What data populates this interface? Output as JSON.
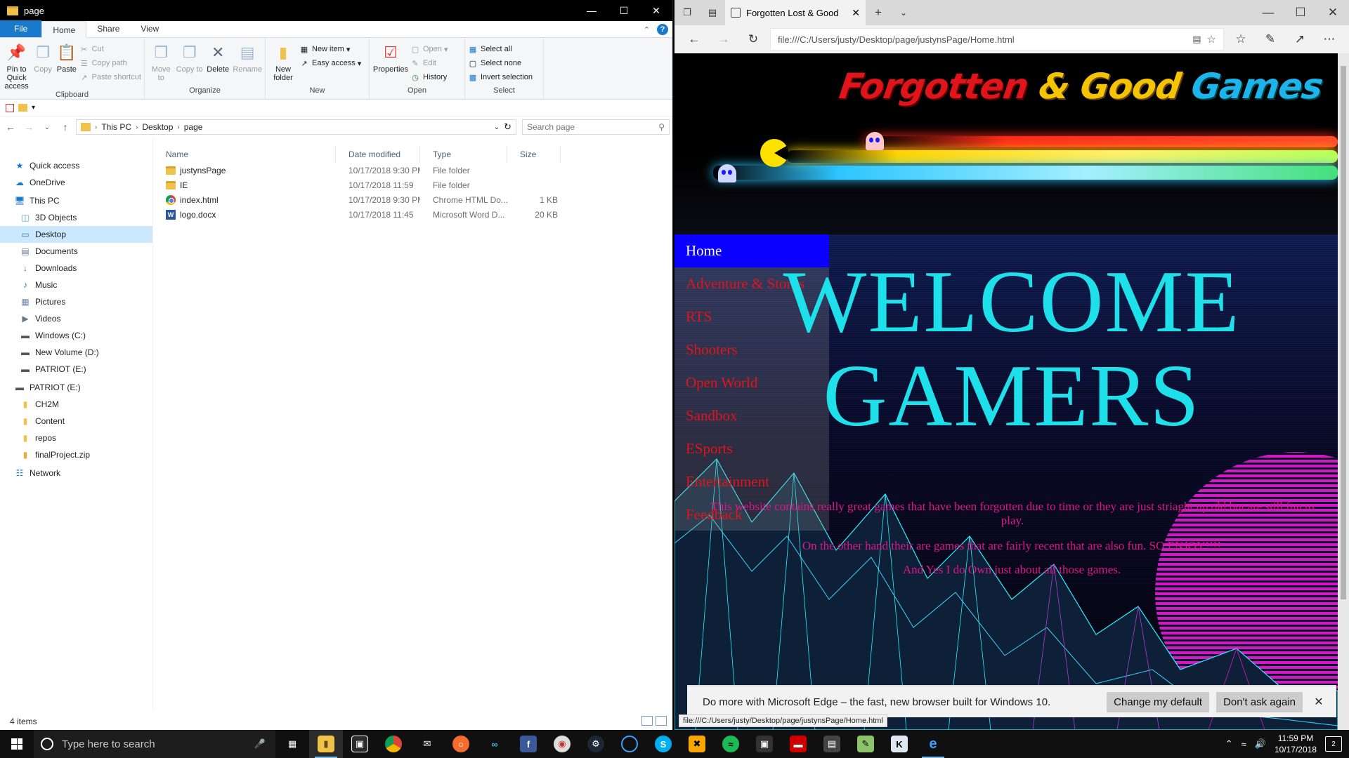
{
  "explorer": {
    "title": "page",
    "ribbon_tabs": [
      "File",
      "Home",
      "Share",
      "View"
    ],
    "groups": {
      "clipboard": {
        "label": "Clipboard",
        "pin": "Pin to Quick access",
        "copy": "Copy",
        "paste": "Paste",
        "cut": "Cut",
        "copy_path": "Copy path",
        "paste_shortcut": "Paste shortcut"
      },
      "organize": {
        "label": "Organize",
        "move_to": "Move to",
        "copy_to": "Copy to",
        "delete": "Delete",
        "rename": "Rename"
      },
      "new": {
        "label": "New",
        "new_folder": "New folder",
        "new_item": "New item",
        "easy_access": "Easy access"
      },
      "open": {
        "label": "Open",
        "properties": "Properties",
        "open": "Open",
        "edit": "Edit",
        "history": "History"
      },
      "select": {
        "label": "Select",
        "select_all": "Select all",
        "select_none": "Select none",
        "invert_selection": "Invert selection"
      }
    },
    "breadcrumb": [
      "This PC",
      "Desktop",
      "page"
    ],
    "search_placeholder": "Search page",
    "nav_pane": [
      {
        "label": "Quick access",
        "icon": "star-icon",
        "indent": 1
      },
      {
        "label": "OneDrive",
        "icon": "cloud-icon",
        "indent": 1
      },
      {
        "label": "This PC",
        "icon": "computer-icon",
        "indent": 1
      },
      {
        "label": "3D Objects",
        "icon": "cube-icon",
        "indent": 2
      },
      {
        "label": "Desktop",
        "icon": "desktop-icon",
        "indent": 2,
        "selected": true
      },
      {
        "label": "Documents",
        "icon": "document-icon",
        "indent": 2
      },
      {
        "label": "Downloads",
        "icon": "download-icon",
        "indent": 2
      },
      {
        "label": "Music",
        "icon": "music-icon",
        "indent": 2
      },
      {
        "label": "Pictures",
        "icon": "picture-icon",
        "indent": 2
      },
      {
        "label": "Videos",
        "icon": "video-icon",
        "indent": 2
      },
      {
        "label": "Windows (C:)",
        "icon": "drive-icon",
        "indent": 2
      },
      {
        "label": "New Volume (D:)",
        "icon": "drive-icon",
        "indent": 2
      },
      {
        "label": "PATRIOT (E:)",
        "icon": "usb-drive-icon",
        "indent": 2
      },
      {
        "label": "PATRIOT (E:)",
        "icon": "usb-drive-icon",
        "indent": 1
      },
      {
        "label": "CH2M",
        "icon": "folder-icon",
        "indent": 2
      },
      {
        "label": "Content",
        "icon": "folder-icon",
        "indent": 2
      },
      {
        "label": "repos",
        "icon": "folder-icon",
        "indent": 2
      },
      {
        "label": "finalProject.zip",
        "icon": "zip-folder-icon",
        "indent": 2
      },
      {
        "label": "Network",
        "icon": "network-icon",
        "indent": 1
      }
    ],
    "columns": [
      "Name",
      "Date modified",
      "Type",
      "Size"
    ],
    "files": [
      {
        "name": "justynsPage",
        "date": "10/17/2018 9:30 PM",
        "type": "File folder",
        "size": "",
        "icon": "folder"
      },
      {
        "name": "IE",
        "date": "10/17/2018 11:59",
        "type": "File folder",
        "size": "",
        "icon": "folder"
      },
      {
        "name": "index.html",
        "date": "10/17/2018 9:30 PM",
        "type": "Chrome HTML Do...",
        "size": "1 KB",
        "icon": "chrome"
      },
      {
        "name": "logo.docx",
        "date": "10/17/2018 11:45",
        "type": "Microsoft Word D...",
        "size": "20 KB",
        "icon": "word"
      }
    ],
    "status": "4 items"
  },
  "edge": {
    "tab_title": "Forgotten Lost & Good",
    "url": "file:///C:/Users/justy/Desktop/page/justynsPage/Home.html",
    "page": {
      "logo": {
        "w1": "Forgotten",
        "w2": "& Good",
        "w3": "Games"
      },
      "nav": [
        "Home",
        "Adventure & Storys",
        "RTS",
        "Shooters",
        "Open World",
        "Sandbox",
        "ESports",
        "Entertainment",
        "Feedback"
      ],
      "heading_line1": "WELCOME",
      "heading_line2": "GAMERS",
      "para1": "This website contains really great games that have been forgotten due to time or they are just striaght up old but are still fun to play.",
      "para2": "On the other hand their are games that are fairly recent that are also fun. SO ENJOY!!!!",
      "para3": "And Yes I do Own just about all those games."
    },
    "notice": {
      "text": "Do more with Microsoft Edge – the fast, new browser built for Windows 10.",
      "btn_default": "Change my default",
      "btn_dismiss": "Don't ask again"
    },
    "status_url": "file:///C:/Users/justy/Desktop/page/justynsPage/Home.html"
  },
  "taskbar": {
    "search_placeholder": "Type here to search",
    "time": "11:59 PM",
    "date": "10/17/2018",
    "notification_count": "2",
    "colors": {
      "accent": "#76b9ed"
    }
  }
}
